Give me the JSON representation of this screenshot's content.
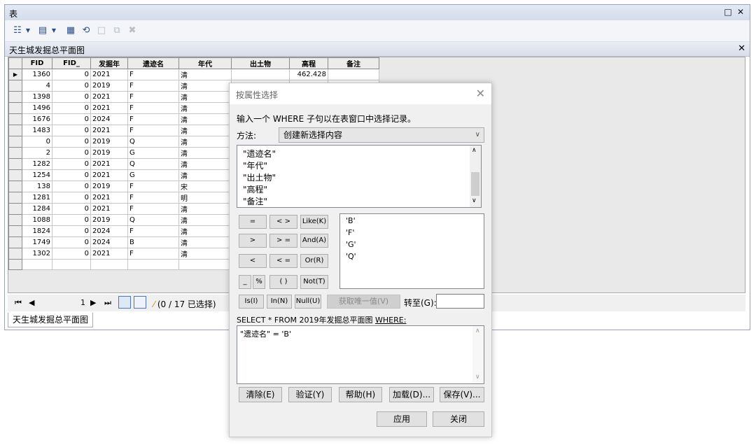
{
  "window": {
    "title": "表",
    "minimize": "□",
    "close": "✕"
  },
  "tab": {
    "title": "天生城发掘总平面图",
    "close": "✕"
  },
  "table": {
    "columns": [
      "FID",
      "FID_",
      "发掘年",
      "遗迹名",
      "年代",
      "出土物",
      "高程",
      "备注"
    ],
    "rows": [
      [
        "1360",
        "0",
        "2021",
        "F",
        "清",
        "",
        "462.428",
        ""
      ],
      [
        "4",
        "0",
        "2019",
        "F",
        "清",
        "",
        "",
        ""
      ],
      [
        "1398",
        "0",
        "2021",
        "F",
        "清",
        "",
        "",
        ""
      ],
      [
        "1496",
        "0",
        "2021",
        "F",
        "清",
        "",
        "",
        ""
      ],
      [
        "1676",
        "0",
        "2024",
        "F",
        "清",
        "",
        "",
        ""
      ],
      [
        "1483",
        "0",
        "2021",
        "F",
        "清",
        "",
        "",
        ""
      ],
      [
        "0",
        "0",
        "2019",
        "Q",
        "清",
        "",
        "",
        ""
      ],
      [
        "2",
        "0",
        "2019",
        "G",
        "清",
        "",
        "",
        ""
      ],
      [
        "1282",
        "0",
        "2021",
        "Q",
        "清",
        "",
        "",
        ""
      ],
      [
        "1254",
        "0",
        "2021",
        "G",
        "清",
        "",
        "",
        ""
      ],
      [
        "138",
        "0",
        "2019",
        "F",
        "宋",
        "",
        "",
        ""
      ],
      [
        "1281",
        "0",
        "2021",
        "F",
        "明",
        "",
        "",
        ""
      ],
      [
        "1284",
        "0",
        "2021",
        "F",
        "清",
        "",
        "",
        ""
      ],
      [
        "1088",
        "0",
        "2019",
        "Q",
        "清",
        "",
        "",
        ""
      ],
      [
        "1824",
        "0",
        "2024",
        "F",
        "清",
        "",
        "",
        ""
      ],
      [
        "1749",
        "0",
        "2024",
        "B",
        "清",
        "",
        "",
        ""
      ],
      [
        "1302",
        "0",
        "2021",
        "F",
        "清",
        "",
        "",
        ""
      ]
    ]
  },
  "navbar": {
    "current_record": "1",
    "selection_status": "(0 / 17 已选择)"
  },
  "bottom_tab": "天生城发掘总平面图",
  "dialog": {
    "title": "按属性选择",
    "close": "✕",
    "instruction": "输入一个 WHERE 子句以在表窗口中选择记录。",
    "method_label": "方法:",
    "method_value": "创建新选择内容",
    "fields": [
      "\"遗迹名\"",
      "\"年代\"",
      "\"出土物\"",
      "\"高程\"",
      "\"备注\""
    ],
    "operators": {
      "eq": "=",
      "neq": "< >",
      "like": "Like(K)",
      "gt": ">",
      "gte": "> =",
      "and": "And(A)",
      "lt": "<",
      "lte": "< =",
      "or": "Or(R)",
      "underscore": "_",
      "percent": "%",
      "parens": "( )",
      "not": "Not(T)",
      "is": "Is(I)",
      "in": "In(N)",
      "null": "Null(U)"
    },
    "values": [
      "'B'",
      "'F'",
      "'G'",
      "'Q'"
    ],
    "get_unique_label": "获取唯一值(V)",
    "goto_label": "转至(G):",
    "goto_value": "",
    "sql_prefix": "SELECT * FROM 2019年发掘总平面图 ",
    "sql_where": "WHERE:",
    "where_clause": "\"遗迹名\" = 'B'",
    "buttons": {
      "clear": "清除(E)",
      "verify": "验证(Y)",
      "help": "帮助(H)",
      "load": "加载(D)...",
      "save": "保存(V)...",
      "apply": "应用",
      "close": "关闭"
    }
  }
}
